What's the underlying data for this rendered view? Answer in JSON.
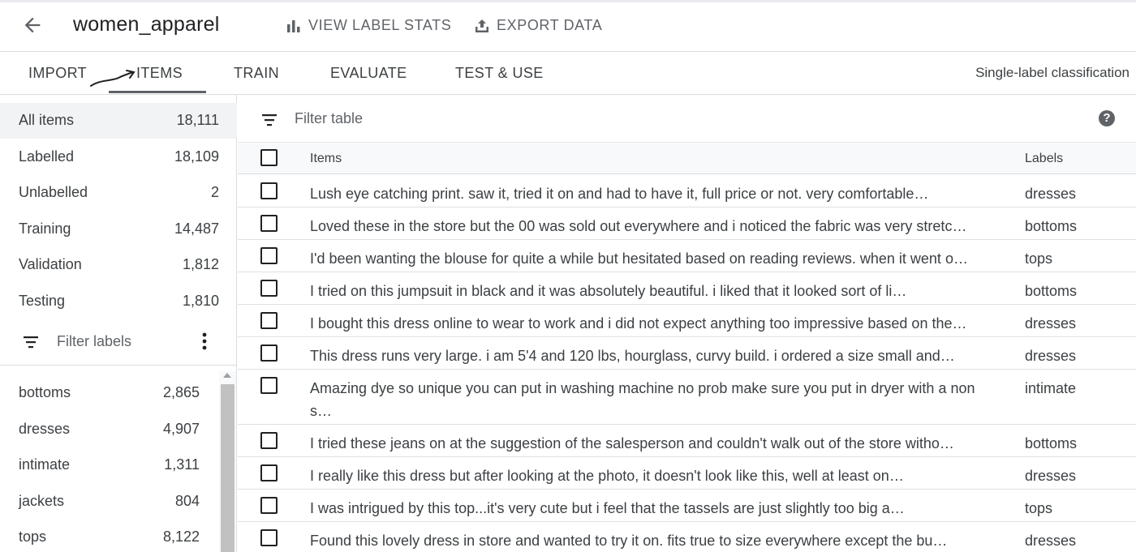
{
  "header": {
    "back_icon": "arrow-back-icon",
    "title": "women_apparel",
    "view_label_stats": "VIEW LABEL STATS",
    "export_data": "EXPORT DATA"
  },
  "tabs": {
    "import": "IMPORT",
    "items": "ITEMS",
    "train": "TRAIN",
    "evaluate": "EVALUATE",
    "test_use": "TEST & USE",
    "active": "ITEMS",
    "mode": "Single-label classification"
  },
  "sidebar": {
    "splits": [
      {
        "label": "All items",
        "count": "18,111"
      },
      {
        "label": "Labelled",
        "count": "18,109"
      },
      {
        "label": "Unlabelled",
        "count": "2"
      },
      {
        "label": "Training",
        "count": "14,487"
      },
      {
        "label": "Validation",
        "count": "1,812"
      },
      {
        "label": "Testing",
        "count": "1,810"
      }
    ],
    "filter_placeholder": "Filter labels",
    "labels": [
      {
        "label": "bottoms",
        "count": "2,865"
      },
      {
        "label": "dresses",
        "count": "4,907"
      },
      {
        "label": "intimate",
        "count": "1,311"
      },
      {
        "label": "jackets",
        "count": "804"
      },
      {
        "label": "tops",
        "count": "8,122"
      }
    ]
  },
  "table": {
    "filter_placeholder": "Filter table",
    "help_icon": "help-icon",
    "columns": {
      "items": "Items",
      "labels": "Labels"
    },
    "rows": [
      {
        "text": "Lush eye catching print. saw it, tried it on and had to have it, full price or not. very comfortable…",
        "label": "dresses"
      },
      {
        "text": "Loved these in the store but the 00 was sold out everywhere and i noticed the fabric was very stretc…",
        "label": "bottoms"
      },
      {
        "text": "I'd been wanting the blouse for quite a while but hesitated based on reading reviews. when it went o…",
        "label": "tops"
      },
      {
        "text": "I tried on this jumpsuit in black and it was absolutely beautiful. i liked that it looked sort of li…",
        "label": "bottoms"
      },
      {
        "text": "I bought this dress online to wear to work and i did not expect anything too impressive based on the…",
        "label": "dresses"
      },
      {
        "text": "This dress runs very large. i am 5'4 and 120 lbs, hourglass, curvy build. i ordered a size small and…",
        "label": "dresses"
      },
      {
        "text": "Amazing dye so unique you can put in washing machine no prob make sure you put in dryer with a non s…",
        "label": "intimate"
      },
      {
        "text": "I tried these jeans on at the suggestion of the salesperson and couldn't walk out of the store witho…",
        "label": "bottoms"
      },
      {
        "text": "I really like this dress but after looking at the photo, it doesn't look like this, well at least on…",
        "label": "dresses"
      },
      {
        "text": "I was intrigued by this top...it's very cute but i feel that the tassels are just slightly too big a…",
        "label": "tops"
      },
      {
        "text": "Found this lovely dress in store and wanted to try it on. fits true to size everywhere except the bu…",
        "label": "dresses"
      }
    ]
  }
}
